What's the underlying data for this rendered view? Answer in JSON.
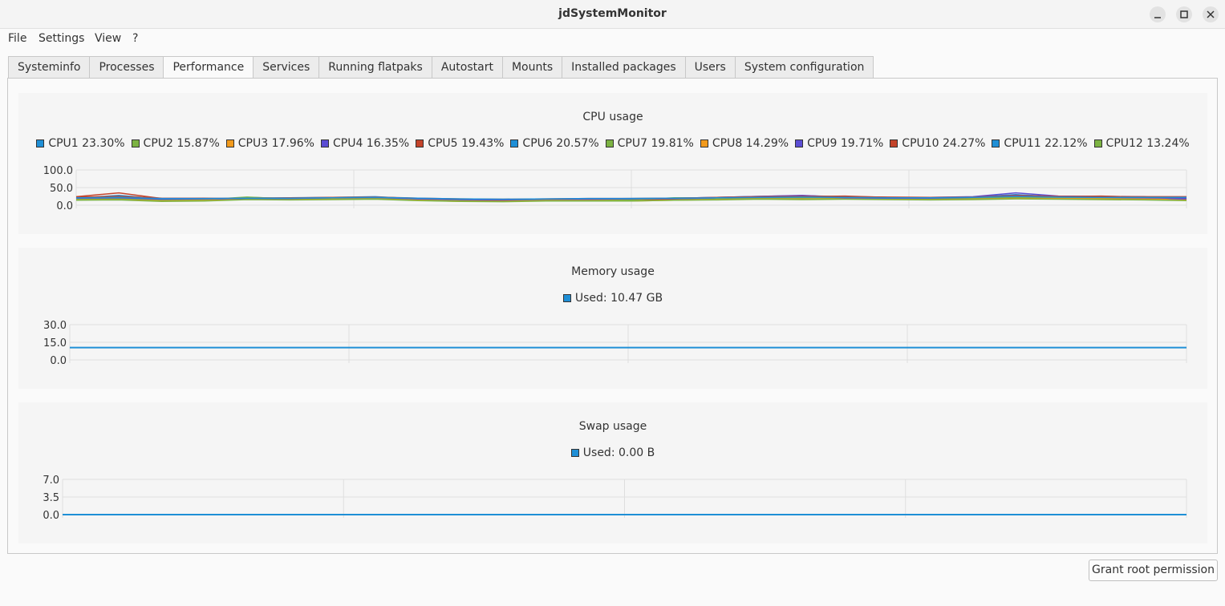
{
  "window": {
    "title": "jdSystemMonitor"
  },
  "menu": [
    "File",
    "Settings",
    "View",
    "?"
  ],
  "tabs": [
    "Systeminfo",
    "Processes",
    "Performance",
    "Services",
    "Running flatpaks",
    "Autostart",
    "Mounts",
    "Installed packages",
    "Users",
    "System configuration"
  ],
  "active_tab": "Performance",
  "buttons": {
    "grant_root": "Grant root permission"
  },
  "colors": {
    "cpu_series": [
      "#1f8fd6",
      "#7cb342",
      "#f29a1c",
      "#5b4dd4",
      "#c4432a",
      "#1f8fd6",
      "#7cb342",
      "#f29a1c",
      "#5b4dd4",
      "#c4432a",
      "#1f8fd6",
      "#7cb342"
    ],
    "memory": "#1f8fd6",
    "swap": "#1f8fd6"
  },
  "chart_data": [
    {
      "type": "line",
      "title": "CPU usage",
      "legend": [
        "CPU1 23.30%",
        "CPU2 15.87%",
        "CPU3 17.96%",
        "CPU4 16.35%",
        "CPU5 19.43%",
        "CPU6 20.57%",
        "CPU7 19.81%",
        "CPU8 14.29%",
        "CPU9 19.71%",
        "CPU10 24.27%",
        "CPU11 22.12%",
        "CPU12 13.24%"
      ],
      "yticks": [
        "100.0",
        "50.0",
        "0.0"
      ],
      "ylim": [
        0,
        100
      ],
      "series": [
        {
          "values": [
            20,
            28,
            18,
            17,
            19,
            21,
            22,
            24,
            18,
            16,
            15,
            17,
            18,
            19,
            20,
            22,
            25,
            27,
            24,
            22,
            21,
            23,
            30,
            24,
            22,
            23,
            23
          ]
        },
        {
          "values": [
            16,
            18,
            12,
            15,
            22,
            19,
            18,
            20,
            15,
            13,
            12,
            15,
            16,
            16,
            15,
            19,
            20,
            22,
            21,
            20,
            18,
            19,
            23,
            19,
            18,
            20,
            16
          ]
        },
        {
          "values": [
            18,
            17,
            13,
            14,
            20,
            18,
            20,
            22,
            16,
            12,
            12,
            16,
            14,
            13,
            17,
            20,
            22,
            20,
            22,
            21,
            19,
            20,
            24,
            25,
            21,
            19,
            18
          ]
        },
        {
          "values": [
            22,
            20,
            16,
            17,
            18,
            20,
            21,
            23,
            19,
            16,
            14,
            16,
            18,
            18,
            20,
            22,
            25,
            28,
            22,
            21,
            22,
            24,
            35,
            26,
            25,
            24,
            16
          ]
        },
        {
          "values": [
            24,
            35,
            19,
            20,
            18,
            20,
            20,
            22,
            18,
            15,
            14,
            16,
            17,
            16,
            18,
            21,
            23,
            24,
            26,
            22,
            18,
            22,
            28,
            24,
            26,
            23,
            19
          ]
        },
        {
          "values": [
            19,
            21,
            18,
            18,
            19,
            20,
            20,
            22,
            19,
            17,
            16,
            17,
            18,
            18,
            19,
            20,
            21,
            22,
            22,
            21,
            21,
            22,
            24,
            22,
            21,
            21,
            21
          ]
        },
        {
          "values": [
            17,
            19,
            15,
            16,
            23,
            18,
            19,
            19,
            17,
            15,
            15,
            15,
            16,
            15,
            21,
            20,
            19,
            21,
            20,
            19,
            18,
            19,
            22,
            20,
            20,
            21,
            20
          ]
        },
        {
          "values": [
            15,
            16,
            12,
            13,
            17,
            16,
            17,
            18,
            14,
            11,
            11,
            13,
            13,
            12,
            14,
            16,
            18,
            17,
            18,
            17,
            16,
            17,
            19,
            19,
            18,
            17,
            14
          ]
        },
        {
          "values": [
            20,
            21,
            17,
            18,
            19,
            19,
            21,
            22,
            18,
            16,
            15,
            17,
            17,
            18,
            19,
            21,
            23,
            25,
            21,
            20,
            20,
            22,
            28,
            24,
            22,
            21,
            20
          ]
        },
        {
          "values": [
            23,
            25,
            20,
            19,
            20,
            21,
            22,
            23,
            20,
            18,
            17,
            18,
            19,
            19,
            20,
            22,
            24,
            25,
            24,
            23,
            22,
            23,
            27,
            25,
            24,
            24,
            24
          ]
        },
        {
          "values": [
            21,
            22,
            19,
            19,
            20,
            20,
            21,
            22,
            20,
            18,
            17,
            18,
            19,
            19,
            20,
            21,
            22,
            23,
            22,
            21,
            21,
            22,
            25,
            23,
            22,
            22,
            22
          ]
        },
        {
          "values": [
            14,
            15,
            11,
            12,
            16,
            15,
            16,
            17,
            13,
            11,
            10,
            12,
            12,
            12,
            14,
            15,
            17,
            16,
            17,
            16,
            15,
            16,
            18,
            17,
            16,
            15,
            13
          ]
        }
      ]
    },
    {
      "type": "line",
      "title": "Memory usage",
      "legend": [
        "Used: 10.47 GB"
      ],
      "yticks": [
        "30.0",
        "15.0",
        "0.0"
      ],
      "ylim": [
        0,
        30
      ],
      "series": [
        {
          "values": [
            10.47,
            10.47
          ]
        }
      ]
    },
    {
      "type": "line",
      "title": "Swap usage",
      "legend": [
        "Used: 0.00 B"
      ],
      "yticks": [
        "7.0",
        "3.5",
        "0.0"
      ],
      "ylim": [
        0,
        7
      ],
      "series": [
        {
          "values": [
            0,
            0
          ]
        }
      ]
    }
  ]
}
